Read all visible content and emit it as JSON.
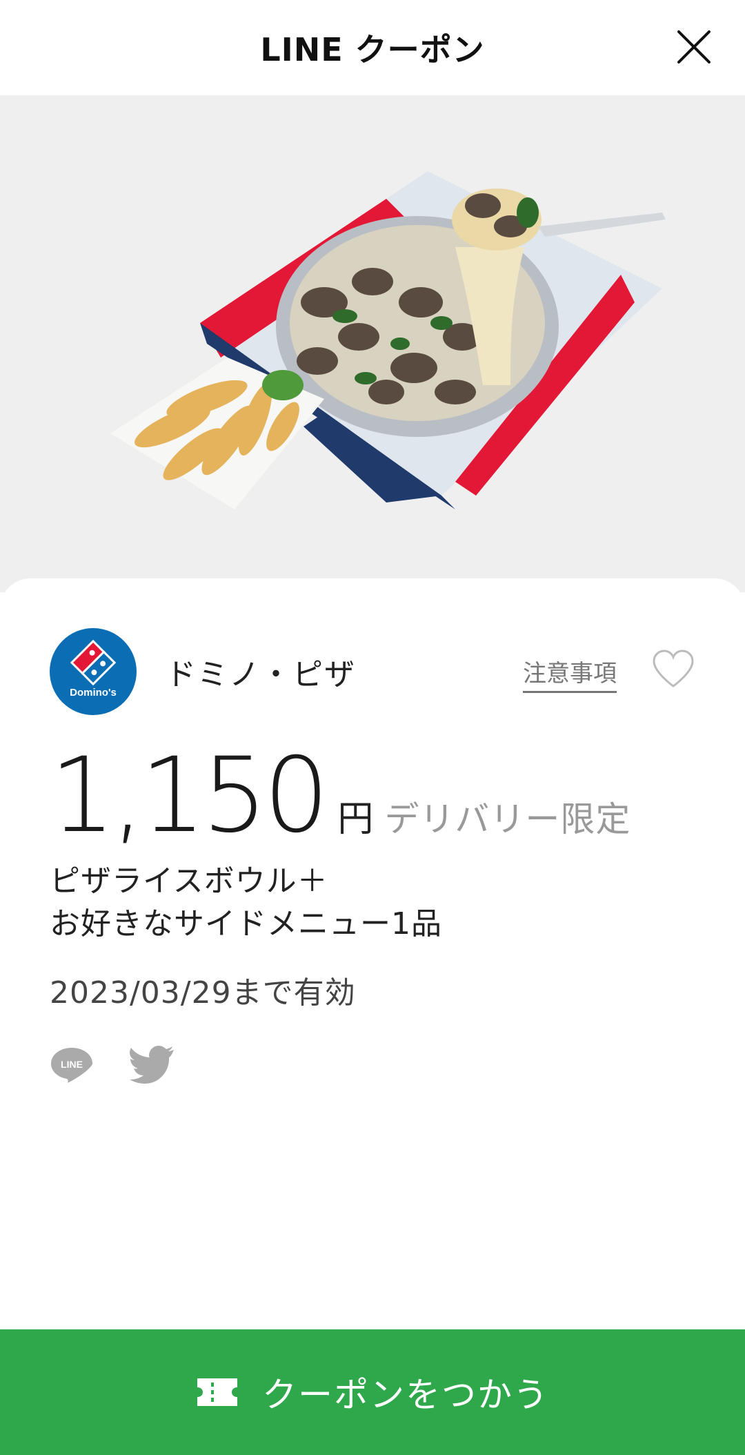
{
  "header": {
    "title": "LINE クーポン"
  },
  "store": {
    "name": "ドミノ・ピザ",
    "logo_text": "Domino's",
    "notes_label": "注意事項"
  },
  "coupon": {
    "price": "1,150",
    "currency": "円",
    "limit_label": "デリバリー限定",
    "description_line1": "ピザライスボウル＋",
    "description_line2": "お好きなサイドメニュー1品",
    "valid_until": "2023/03/29まで有効"
  },
  "share": {
    "line_icon_text": "LINE"
  },
  "cta": {
    "label": "クーポンをつかう"
  },
  "colors": {
    "accent": "#2ea84b",
    "brand_blue": "#0b6db3",
    "brand_red": "#e31837"
  }
}
